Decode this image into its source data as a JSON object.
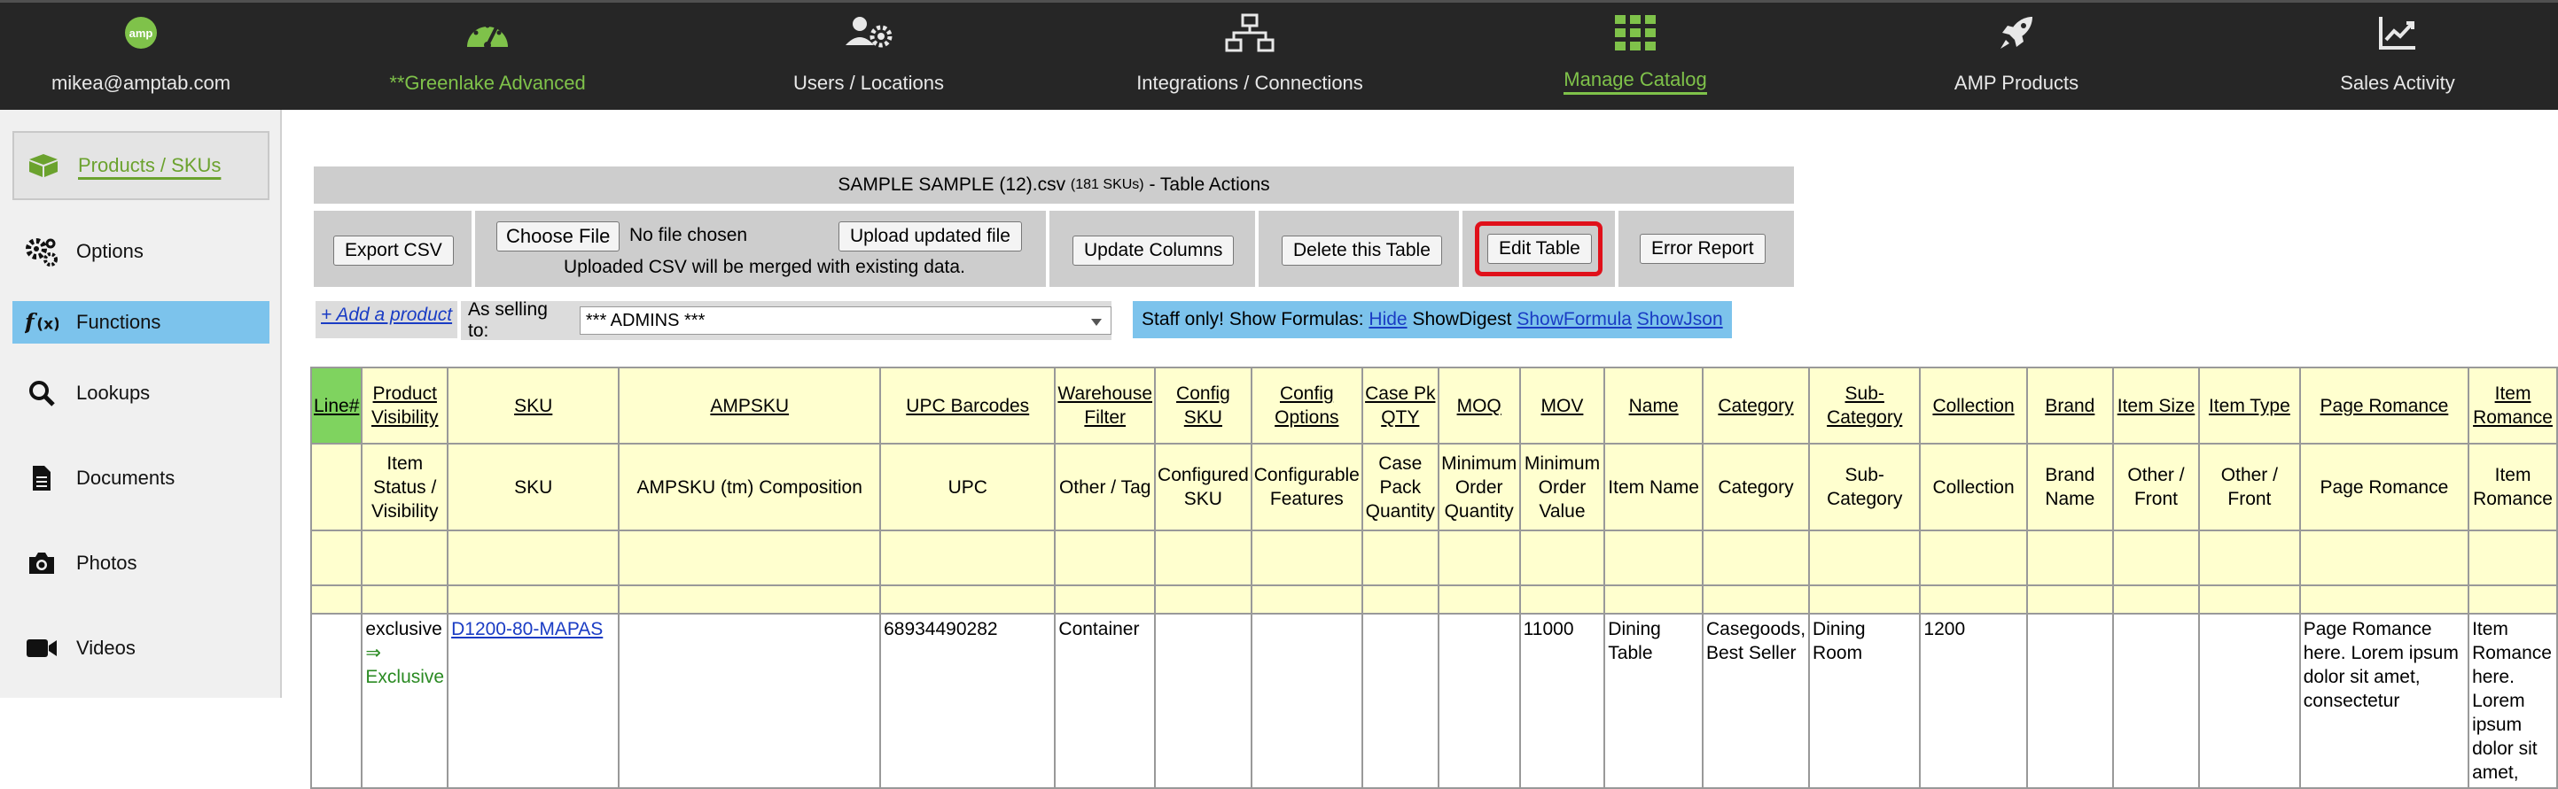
{
  "topnav": {
    "user_email": "mikea@amptab.com",
    "logo_text": "amp",
    "items": [
      {
        "label": "**Greenlake Advanced",
        "icon": "speedometer-icon",
        "color": "#7fc24a"
      },
      {
        "label": "Users / Locations",
        "icon": "users-gear-icon"
      },
      {
        "label": "Integrations / Connections",
        "icon": "network-icon"
      },
      {
        "label": "Manage Catalog",
        "icon": "grid-icon",
        "color": "#7fc24a"
      },
      {
        "label": "AMP Products",
        "icon": "rocket-icon"
      },
      {
        "label": "Sales Activity",
        "icon": "chart-line-icon"
      }
    ]
  },
  "sidebar": {
    "items": [
      {
        "label": "Products / SKUs",
        "icon": "box-icon"
      },
      {
        "label": "Options",
        "icon": "gears-icon"
      },
      {
        "label": "Functions",
        "icon": "function-icon"
      },
      {
        "label": "Lookups",
        "icon": "search-icon"
      },
      {
        "label": "Documents",
        "icon": "document-icon"
      },
      {
        "label": "Photos",
        "icon": "camera-icon"
      },
      {
        "label": "Videos",
        "icon": "video-icon"
      }
    ]
  },
  "table_actions": {
    "title": "SAMPLE SAMPLE (12).csv",
    "sku_count": "(181 SKUs)",
    "title_suffix": "- Table Actions",
    "export_csv": "Export CSV",
    "choose_file": "Choose File",
    "no_file": "No file chosen",
    "upload": "Upload updated file",
    "merge_note": "Uploaded CSV will be merged with existing data.",
    "update_columns": "Update Columns",
    "delete_table": "Delete this Table",
    "edit_table": "Edit Table",
    "error_report": "Error Report"
  },
  "controls": {
    "add_product": "+ Add a product",
    "selling_to_label": "As selling to:",
    "selling_to_value": "*** ADMINS ***",
    "staff_label": "Staff only! Show Formulas:",
    "hide": "Hide",
    "show_digest": "ShowDigest",
    "show_formula": "ShowFormula",
    "show_json": "ShowJson"
  },
  "table": {
    "headers": [
      "Line#",
      "Product Visibility",
      "SKU",
      "AMPSKU",
      "UPC Barcodes",
      "Warehouse Filter",
      "Config SKU",
      "Config Options",
      "Case Pk QTY",
      "MOQ",
      "MOV",
      "Name",
      "Category",
      "Sub-Category",
      "Collection",
      "Brand",
      "Item Size",
      "Item Type",
      "Page Romance",
      "Item Romance"
    ],
    "subheaders": [
      "",
      "Item Status / Visibility",
      "SKU",
      "AMPSKU (tm) Composition",
      "UPC",
      "Other / Tag",
      "Configured SKU",
      "Configurable Features",
      "Case Pack Quantity",
      "Minimum Order Quantity",
      "Minimum Order Value",
      "Item Name",
      "Category",
      "Sub-Category",
      "Collection",
      "Brand Name",
      "Other / Front",
      "Other / Front",
      "Page Romance",
      "Item Romance"
    ],
    "row": {
      "visibility": "exclusive",
      "visibility_arrow": "⇒",
      "visibility_result": "Exclusive",
      "sku": "D1200-80-MAPAS",
      "upc": "68934490282",
      "warehouse": "Container",
      "mov": "11000",
      "name": "Dining Table",
      "category": "Casegoods, Best Seller",
      "subcategory": "Dining Room",
      "collection": "1200",
      "page_romance": "Page Romance here. Lorem ipsum dolor sit amet, consectetur",
      "item_romance": "Item Romance here. Lorem ipsum dolor sit amet,"
    }
  }
}
